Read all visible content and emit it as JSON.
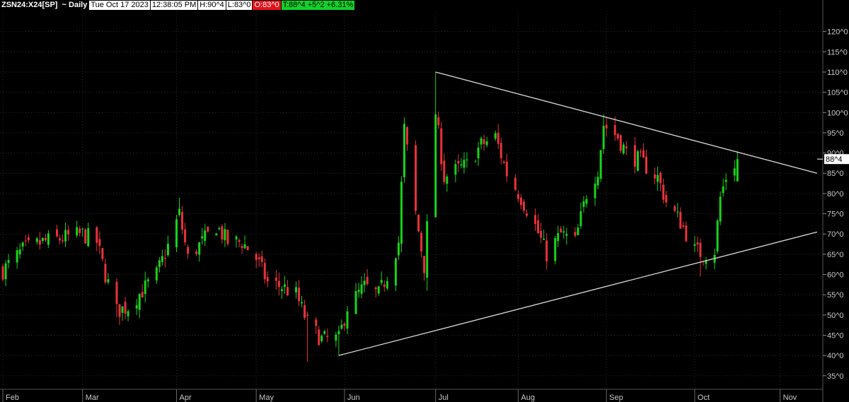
{
  "header": {
    "symbol": "ZSN24:X24[SP]",
    "interval": "~ Daily",
    "date": "Tue Oct 17 2023",
    "time": "12:38:05 PM",
    "high": "H:90^4",
    "low": "L:83^0",
    "open": "O:83^0",
    "close_change": "T:88^4 +5^2 +6.31%"
  },
  "colors": {
    "background": "#000000",
    "up_candle": "#19d319",
    "down_candle": "#e8323a",
    "trendline": "#d8d8d8",
    "grid": "#2a2a2a",
    "axis_text": "#c8c8c8",
    "open_box": "#e8101a",
    "change_box": "#10d22a"
  },
  "chart_data": {
    "type": "candlestick",
    "title": "ZSN24:X24[SP] ~ Daily",
    "xlabel": "",
    "ylabel": "",
    "ylim": [
      32,
      125
    ],
    "y_ticks": [
      35,
      40,
      45,
      50,
      55,
      60,
      65,
      70,
      75,
      80,
      85,
      90,
      95,
      100,
      105,
      110,
      115,
      120
    ],
    "y_tick_labels": [
      "35^0",
      "40^0",
      "45^0",
      "50^0",
      "55^0",
      "60^0",
      "65^0",
      "70^0",
      "75^0",
      "80^0",
      "85^0",
      "90^0",
      "95^0",
      "100^0",
      "105^0",
      "110^0",
      "115^0",
      "120^0"
    ],
    "x_range": [
      "2023-01-31",
      "2023-11-16"
    ],
    "month_labels": [
      {
        "date": "2023-02-01",
        "label": "Feb"
      },
      {
        "date": "2023-03-01",
        "label": "Mar"
      },
      {
        "date": "2023-04-03",
        "label": "Apr"
      },
      {
        "date": "2023-05-01",
        "label": "May"
      },
      {
        "date": "2023-06-01",
        "label": "Jun"
      },
      {
        "date": "2023-07-03",
        "label": "Jul"
      },
      {
        "date": "2023-08-01",
        "label": "Aug"
      },
      {
        "date": "2023-09-01",
        "label": "Sep"
      },
      {
        "date": "2023-10-02",
        "label": "Oct"
      },
      {
        "date": "2023-11-01",
        "label": "Nov"
      }
    ],
    "last_price_label": "88^4",
    "last_price": 88.5,
    "close_path": [
      [
        "2023-02-01",
        61
      ],
      [
        "2023-02-08",
        66
      ],
      [
        "2023-02-15",
        68
      ],
      [
        "2023-02-22",
        69
      ],
      [
        "2023-03-01",
        70
      ],
      [
        "2023-03-06",
        68
      ],
      [
        "2023-03-09",
        60
      ],
      [
        "2023-03-13",
        51
      ],
      [
        "2023-03-17",
        52
      ],
      [
        "2023-03-22",
        56
      ],
      [
        "2023-03-27",
        60
      ],
      [
        "2023-03-31",
        67
      ],
      [
        "2023-04-04",
        75
      ],
      [
        "2023-04-07",
        64
      ],
      [
        "2023-04-12",
        68
      ],
      [
        "2023-04-17",
        72
      ],
      [
        "2023-04-21",
        68
      ],
      [
        "2023-04-26",
        68
      ],
      [
        "2023-05-01",
        64
      ],
      [
        "2023-05-05",
        58
      ],
      [
        "2023-05-10",
        57
      ],
      [
        "2023-05-15",
        55
      ],
      [
        "2023-05-19",
        48
      ],
      [
        "2023-05-24",
        44
      ],
      [
        "2023-05-30",
        44
      ],
      [
        "2023-06-02",
        52
      ],
      [
        "2023-06-08",
        57
      ],
      [
        "2023-06-13",
        55
      ],
      [
        "2023-06-16",
        60
      ],
      [
        "2023-06-20",
        68
      ],
      [
        "2023-06-22",
        96
      ],
      [
        "2023-06-26",
        75
      ],
      [
        "2023-06-29",
        62
      ],
      [
        "2023-07-03",
        100
      ],
      [
        "2023-07-06",
        84
      ],
      [
        "2023-07-11",
        86
      ],
      [
        "2023-07-14",
        87
      ],
      [
        "2023-07-19",
        92
      ],
      [
        "2023-07-24",
        94
      ],
      [
        "2023-07-28",
        85
      ],
      [
        "2023-08-02",
        79
      ],
      [
        "2023-08-07",
        72
      ],
      [
        "2023-08-11",
        65
      ],
      [
        "2023-08-16",
        70
      ],
      [
        "2023-08-21",
        68
      ],
      [
        "2023-08-25",
        80
      ],
      [
        "2023-08-29",
        86
      ],
      [
        "2023-08-31",
        97
      ],
      [
        "2023-09-05",
        94
      ],
      [
        "2023-09-08",
        90
      ],
      [
        "2023-09-13",
        88
      ],
      [
        "2023-09-19",
        84
      ],
      [
        "2023-09-22",
        78
      ],
      [
        "2023-09-27",
        73
      ],
      [
        "2023-10-02",
        66
      ],
      [
        "2023-10-05",
        65
      ],
      [
        "2023-10-09",
        66
      ],
      [
        "2023-10-11",
        79
      ],
      [
        "2023-10-13",
        84
      ],
      [
        "2023-10-17",
        88.5
      ]
    ],
    "pivots": [
      {
        "date": "2023-03-13",
        "value": 49.5
      },
      {
        "date": "2023-04-04",
        "value": 79
      },
      {
        "date": "2023-05-19",
        "value": 38.5
      },
      {
        "date": "2023-05-30",
        "value": 40
      },
      {
        "date": "2023-06-30",
        "value": 56
      },
      {
        "date": "2023-07-03",
        "value": 110
      },
      {
        "date": "2023-08-14",
        "value": 62.5
      },
      {
        "date": "2023-08-31",
        "value": 99.5
      },
      {
        "date": "2023-10-04",
        "value": 59.5
      },
      {
        "date": "2023-10-17",
        "value": 90.5
      }
    ],
    "trendlines": [
      {
        "from": {
          "date": "2023-07-03",
          "value": 110
        },
        "to": {
          "date": "2023-11-14",
          "value": 85
        }
      },
      {
        "from": {
          "date": "2023-05-30",
          "value": 40
        },
        "to": {
          "date": "2023-11-14",
          "value": 70.5
        }
      }
    ]
  }
}
